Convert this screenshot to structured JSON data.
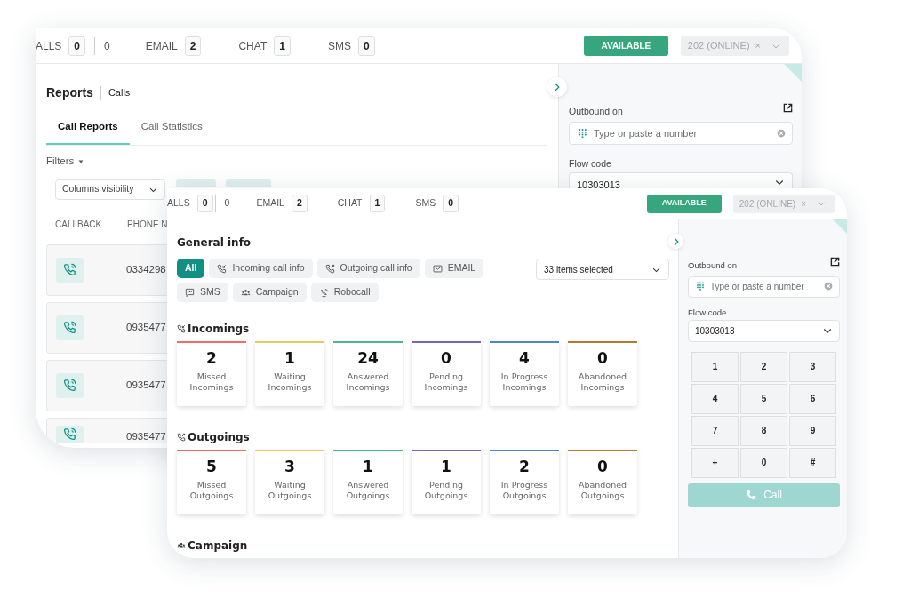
{
  "back_window": {
    "counters": [
      {
        "kind": "boxed",
        "label": "ALLS",
        "value": "0"
      },
      {
        "kind": "plain",
        "value": "0"
      },
      {
        "kind": "boxed",
        "label": "EMAIL",
        "value": "2"
      },
      {
        "kind": "boxed",
        "label": "CHAT",
        "value": "1"
      },
      {
        "kind": "boxed",
        "label": "SMS",
        "value": "0"
      }
    ],
    "status_button": "AVAILABLE",
    "agent_select": "202 (ONLINE)",
    "clear_mark": "×",
    "title": "Reports",
    "subtitle": "Calls",
    "tabs": [
      {
        "label": "Call Reports",
        "selected": true
      },
      {
        "label": "Call Statistics",
        "selected": false
      }
    ],
    "filters": "Filters",
    "columns_select": "Columns visibility",
    "table": {
      "columns": [
        "CALLBACK",
        "PHONE N"
      ],
      "rows": [
        {
          "phone": "0334298"
        },
        {
          "phone": "0935477"
        },
        {
          "phone": "0935477"
        },
        {
          "phone": "0935477"
        }
      ]
    },
    "dialer": {
      "outbound_label": "Outbound on",
      "placeholder": "Type or paste a number",
      "flow_label": "Flow code",
      "flow_value": "10303013"
    }
  },
  "front_window": {
    "counters": [
      {
        "kind": "boxed",
        "label": "ALLS",
        "value": "0"
      },
      {
        "kind": "plain",
        "value": "0"
      },
      {
        "kind": "boxed",
        "label": "EMAIL",
        "value": "2"
      },
      {
        "kind": "boxed",
        "label": "CHAT",
        "value": "1"
      },
      {
        "kind": "boxed",
        "label": "SMS",
        "value": "0"
      }
    ],
    "status_button": "AVAILABLE",
    "agent_select": "202 (ONLINE)",
    "clear_mark": "×",
    "title": "General info",
    "chips": [
      {
        "kind": "all",
        "label": "All",
        "selected": true
      },
      {
        "kind": "incoming",
        "label": "Incoming call info",
        "selected": false
      },
      {
        "kind": "outgoing",
        "label": "Outgoing call info",
        "selected": false
      },
      {
        "kind": "email",
        "label": "EMAIL",
        "selected": false
      },
      {
        "kind": "sms",
        "label": "SMS",
        "selected": false
      },
      {
        "kind": "campaign",
        "label": "Campaign",
        "selected": false
      },
      {
        "kind": "robocall",
        "label": "Robocall",
        "selected": false
      }
    ],
    "items_select": "33 items selected",
    "sections": [
      {
        "kind": "incoming",
        "title": "Incomings",
        "stats": [
          {
            "value": "2",
            "label": "Missed Incomings",
            "color": "#f06b6b"
          },
          {
            "value": "1",
            "label": "Waiting Incomings",
            "color": "#e9c766"
          },
          {
            "value": "24",
            "label": "Answered Incomings",
            "color": "#4bb88c"
          },
          {
            "value": "0",
            "label": "Pending Incomings",
            "color": "#7a63bf"
          },
          {
            "value": "4",
            "label": "In Progress Incomings",
            "color": "#4f86c6"
          },
          {
            "value": "0",
            "label": "Abandoned Incomings",
            "color": "#b07b2c"
          }
        ]
      },
      {
        "kind": "outgoing",
        "title": "Outgoings",
        "stats": [
          {
            "value": "5",
            "label": "Missed Outgoings",
            "color": "#f06b6b"
          },
          {
            "value": "3",
            "label": "Waiting Outgoings",
            "color": "#e9c766"
          },
          {
            "value": "1",
            "label": "Answered Outgoings",
            "color": "#4bb88c"
          },
          {
            "value": "1",
            "label": "Pending Outgoings",
            "color": "#7a63bf"
          },
          {
            "value": "2",
            "label": "In Progress Outgoings",
            "color": "#4f86c6"
          },
          {
            "value": "0",
            "label": "Abandoned Outgoings",
            "color": "#b07b2c"
          }
        ]
      },
      {
        "kind": "campaign",
        "title": "Campaign"
      }
    ],
    "dialer": {
      "outbound_label": "Outbound on",
      "placeholder": "Type or paste a number",
      "flow_label": "Flow code",
      "flow_value": "10303013",
      "keys": [
        "1",
        "2",
        "3",
        "4",
        "5",
        "6",
        "7",
        "8",
        "9",
        "+",
        "0",
        "#"
      ],
      "call_button": "Call"
    }
  }
}
